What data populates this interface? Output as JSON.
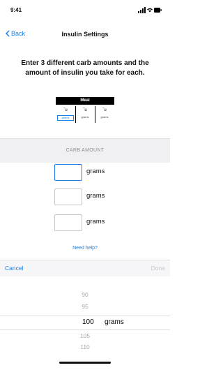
{
  "status": {
    "time": "9:41"
  },
  "nav": {
    "back_label": "Back",
    "title": "Insulin Settings"
  },
  "instruction": "Enter 3 different carb amounts and the amount of insulin you take for each.",
  "meal": {
    "header": "Meal",
    "unit": "u",
    "grams": "grams"
  },
  "section_label": "CARB AMOUNT",
  "carb_unit": "grams",
  "help_link": "Need help?",
  "toolbar": {
    "cancel": "Cancel",
    "done": "Done"
  },
  "picker": {
    "values": [
      "90",
      "95",
      "100",
      "105",
      "110"
    ],
    "selected": "100",
    "unit": "grams"
  },
  "colors": {
    "accent": "#1a7fe4",
    "disabled": "#c7c7cc",
    "band": "#f0f0f2"
  }
}
